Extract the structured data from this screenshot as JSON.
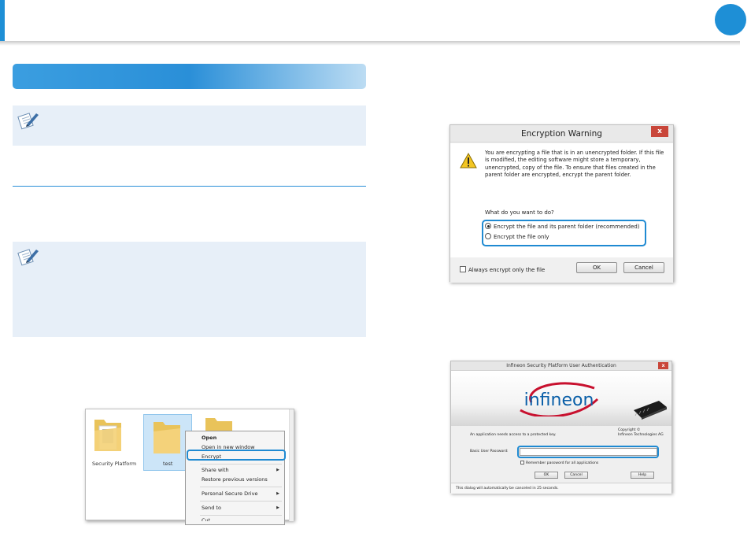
{
  "explorer": {
    "folders": [
      {
        "label": "Security Platform"
      },
      {
        "label": "test"
      },
      {
        "label": ""
      }
    ],
    "context_menu": [
      {
        "label": "Open",
        "bold": true,
        "submenu": false
      },
      {
        "label": "Open in new window",
        "submenu": false
      },
      {
        "label": "Encrypt",
        "submenu": false,
        "highlighted": true
      },
      {
        "label": "Share with",
        "submenu": true
      },
      {
        "label": "Restore previous versions",
        "submenu": false
      },
      {
        "label": "Personal Secure Drive",
        "submenu": true
      },
      {
        "label": "Send to",
        "submenu": true
      },
      {
        "label": "Cut",
        "submenu": false
      }
    ]
  },
  "encryption_warning": {
    "title": "Encryption Warning",
    "close_label": "x",
    "message": "You are encrypting a file that is in an unencrypted folder. If this file is modified, the editing software might store a temporary, unencrypted, copy of the file. To ensure that files created in the parent folder are encrypted, encrypt the parent folder.",
    "question": "What do you want to do?",
    "option_parent": "Encrypt the file and its parent folder (recommended)",
    "option_file": "Encrypt the file only",
    "always_label": "Always encrypt only the file",
    "ok_label": "OK",
    "cancel_label": "Cancel"
  },
  "infineon_auth": {
    "title": "Infineon Security Platform User Authentication",
    "close_label": "x",
    "logo_text": "infineon",
    "copyright_1": "Copyright ©",
    "copyright_2": "Infineon Technologies AG",
    "access_text": "An application needs access to a protected key.",
    "password_label": "Basic User Password:",
    "password_value": "",
    "remember_label": "Remember password for all applications",
    "ok_label": "OK",
    "cancel_label": "Cancel",
    "help_label": "Help",
    "status_text": "This dialog will automatically be canceled in 25 seconds."
  },
  "colors": {
    "accent": "#1e8fd6",
    "highlight_outline": "#1f8ad2",
    "note_background": "#e7eff8",
    "infineon_red": "#c8102e",
    "infineon_blue": "#0a5fa8"
  }
}
